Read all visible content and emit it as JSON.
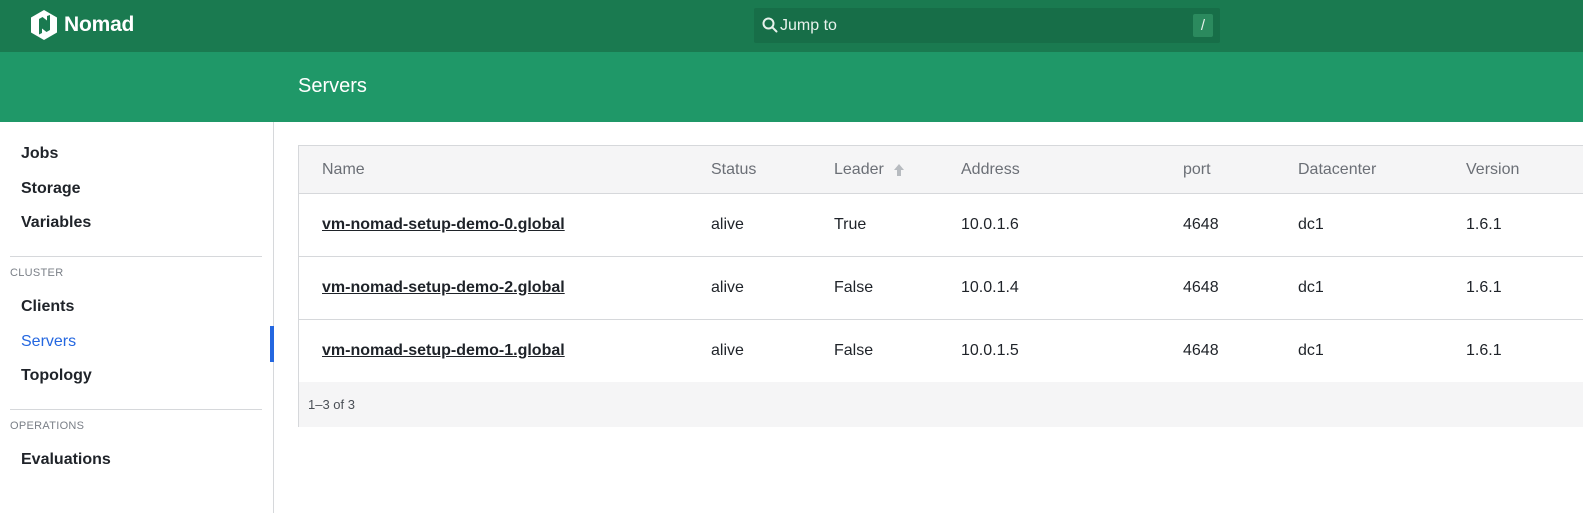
{
  "app": {
    "name": "Nomad"
  },
  "search": {
    "placeholder": "Jump to",
    "shortcut": "/"
  },
  "page": {
    "title": "Servers"
  },
  "sidebar": {
    "items": [
      {
        "label": "Jobs"
      },
      {
        "label": "Storage"
      },
      {
        "label": "Variables"
      }
    ],
    "cluster": {
      "heading": "CLUSTER",
      "items": [
        {
          "label": "Clients"
        },
        {
          "label": "Servers"
        },
        {
          "label": "Topology"
        }
      ]
    },
    "operations": {
      "heading": "OPERATIONS",
      "items": [
        {
          "label": "Evaluations"
        }
      ]
    }
  },
  "table": {
    "columns": [
      "Name",
      "Status",
      "Leader",
      "Address",
      "port",
      "Datacenter",
      "Version"
    ],
    "rows": [
      {
        "name": "vm-nomad-setup-demo-0.global",
        "status": "alive",
        "leader": "True",
        "address": "10.0.1.6",
        "port": "4648",
        "datacenter": "dc1",
        "version": "1.6.1"
      },
      {
        "name": "vm-nomad-setup-demo-2.global",
        "status": "alive",
        "leader": "False",
        "address": "10.0.1.4",
        "port": "4648",
        "datacenter": "dc1",
        "version": "1.6.1"
      },
      {
        "name": "vm-nomad-setup-demo-1.global",
        "status": "alive",
        "leader": "False",
        "address": "10.0.1.5",
        "port": "4648",
        "datacenter": "dc1",
        "version": "1.6.1"
      }
    ],
    "pagination": "1–3 of 3"
  },
  "colors": {
    "topbar": "#1a7a50",
    "pagebar": "#1f9868",
    "active_nav": "#2467e0"
  },
  "icons": {
    "logo": "nomad-logo-icon",
    "search": "search-icon",
    "sort": "sort-ascending-icon"
  }
}
